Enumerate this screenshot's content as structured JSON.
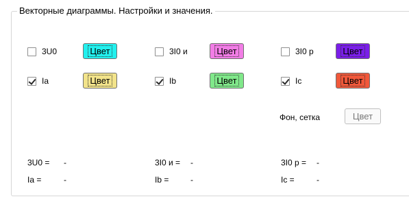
{
  "group_title": "Векторные диаграммы.  Настройки и значения.",
  "color_button_label": "Цвет",
  "row1": [
    {
      "label": "3U0",
      "checked": false,
      "color": "#22f0ee"
    },
    {
      "label": "3I0 и",
      "checked": false,
      "color": "#f27de6"
    },
    {
      "label": "3I0 р",
      "checked": false,
      "color": "#7a1ee8"
    }
  ],
  "row2": [
    {
      "label": "Ia",
      "checked": true,
      "color": "#f2e38a"
    },
    {
      "label": "Ib",
      "checked": true,
      "color": "#80e88a"
    },
    {
      "label": "Ic",
      "checked": true,
      "color": "#f0583a"
    }
  ],
  "background_grid": {
    "label": "Фон, сетка",
    "button_label": "Цвет"
  },
  "values": {
    "u0_label": "3U0 =",
    "u0_value": "-",
    "i0u_label": "3I0 и =",
    "i0u_value": "-",
    "i0p_label": "3I0 р =",
    "i0p_value": "-",
    "ia_label": "Ia =",
    "ia_value": "-",
    "ib_label": "Ib =",
    "ib_value": "-",
    "ic_label": "Ic =",
    "ic_value": "-"
  }
}
